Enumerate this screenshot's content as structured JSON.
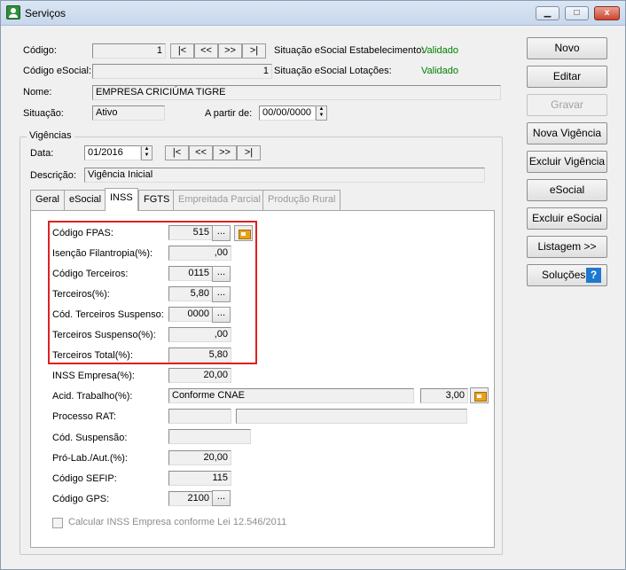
{
  "window": {
    "title": "Serviços",
    "min": "▁",
    "max": "□",
    "close": "x"
  },
  "nav_buttons": {
    "first": "|<",
    "prev": "<<",
    "next": ">>",
    "last": ">|"
  },
  "header": {
    "codigo_label": "Código:",
    "codigo_value": "1",
    "codigo_esocial_label": "Código eSocial:",
    "codigo_esocial_value": "1",
    "situacao_estab_label": "Situação eSocial Estabelecimento:",
    "situacao_estab_value": "Validado",
    "situacao_lot_label": "Situação eSocial Lotações:",
    "situacao_lot_value": "Validado",
    "nome_label": "Nome:",
    "nome_value": "EMPRESA CRICIÚMA TIGRE",
    "situacao_label": "Situação:",
    "situacao_value": "Ativo",
    "a_partir_label": "A partir de:",
    "a_partir_value": "00/00/0000"
  },
  "vigencias": {
    "title": "Vigências",
    "data_label": "Data:",
    "data_value": "01/2016",
    "descricao_label": "Descrição:",
    "descricao_value": "Vigência Inicial"
  },
  "tabs": [
    "Geral",
    "eSocial",
    "INSS",
    "FGTS",
    "Empreitada Parcial",
    "Produção Rural"
  ],
  "inss": {
    "codigo_fpas_label": "Código FPAS:",
    "codigo_fpas_value": "515",
    "isencao_label": "Isenção Filantropia(%):",
    "isencao_value": ",00",
    "codigo_terceiros_label": "Código Terceiros:",
    "codigo_terceiros_value": "0115",
    "terceiros_label": "Terceiros(%):",
    "terceiros_value": "5,80",
    "cod_terceiros_susp_label": "Cód. Terceiros Suspenso:",
    "cod_terceiros_susp_value": "0000",
    "terceiros_susp_label": "Terceiros Suspenso(%):",
    "terceiros_susp_value": ",00",
    "terceiros_total_label": "Terceiros Total(%):",
    "terceiros_total_value": "5,80",
    "inss_empresa_label": "INSS Empresa(%):",
    "inss_empresa_value": "20,00",
    "acid_trabalho_label": "Acid. Trabalho(%):",
    "acid_trabalho_text": "Conforme CNAE",
    "acid_trabalho_value": "3,00",
    "processo_rat_label": "Processo RAT:",
    "cod_suspensao_label": "Cód. Suspensão:",
    "pro_lab_label": "Pró-Lab./Aut.(%):",
    "pro_lab_value": "20,00",
    "codigo_sefip_label": "Código SEFIP:",
    "codigo_sefip_value": "115",
    "codigo_gps_label": "Código GPS:",
    "codigo_gps_value": "2100",
    "calc_label": "Calcular INSS Empresa conforme Lei 12.546/2011",
    "dots": "..."
  },
  "side_buttons": [
    "Novo",
    "Editar",
    "Gravar",
    "Nova Vigência",
    "Excluir Vigência",
    "eSocial",
    "Excluir eSocial",
    "Listagem >>",
    "Soluções"
  ],
  "help_glyph": "?"
}
